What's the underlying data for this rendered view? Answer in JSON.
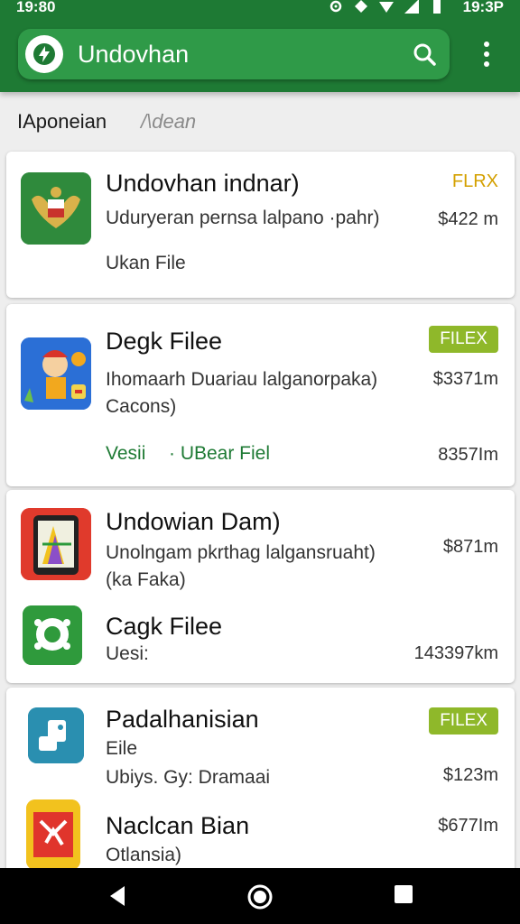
{
  "status": {
    "time_left": "19:80",
    "time_right": "19:3P"
  },
  "appbar": {
    "title": "Undovhan"
  },
  "tabs": [
    {
      "label": "IAponeian"
    },
    {
      "label": "/\\dean"
    }
  ],
  "cards": [
    {
      "items": [
        {
          "title": "Undovhan indnar)",
          "subtitle": "Uduryeran pernsa lalpano ·pahr)",
          "subtitle2": "",
          "extra": "Ukan File",
          "badge": "FLRX",
          "price": "$422 m",
          "icon": "emblem-icon"
        }
      ]
    },
    {
      "items": [
        {
          "title": "Degk Filee",
          "subtitle": "Ihomaarh Duariau lalganorpaka)",
          "subtitle2": "Cacons)",
          "link_left": "Vesii",
          "link_right": "· UBear Fiel",
          "badge": "FILEX",
          "price": "$3371m",
          "price2": "8357Im",
          "icon": "cartoon-character-icon"
        }
      ]
    },
    {
      "items": [
        {
          "title": "Undowian Dam)",
          "subtitle": "Unolngam pkrthag lalgansruaht)",
          "subtitle2": "(ka Faka)",
          "price": "$871m",
          "icon": "tablet-app-icon"
        },
        {
          "title": "Cagk Filee",
          "subtitle": "Uesi:",
          "price": "143397km",
          "icon": "chat-bubble-icon"
        }
      ]
    },
    {
      "items": [
        {
          "title": "Padalhanisian",
          "subtitle": "Eile",
          "subtitle2": "Ubiys. Gy: Dramaai",
          "badge": "FILEX",
          "price": "$123m",
          "icon": "puzzle-app-icon"
        },
        {
          "title": "Naclcan Bian",
          "subtitle": "Otlansia)",
          "price": "$677Im",
          "icon": "red-tile-icon"
        }
      ]
    }
  ],
  "colors": {
    "appbar_green": "#1e7a34",
    "search_green": "#2f9a48",
    "badge_green": "#8fb82a",
    "badge_gold": "#d4a000"
  }
}
